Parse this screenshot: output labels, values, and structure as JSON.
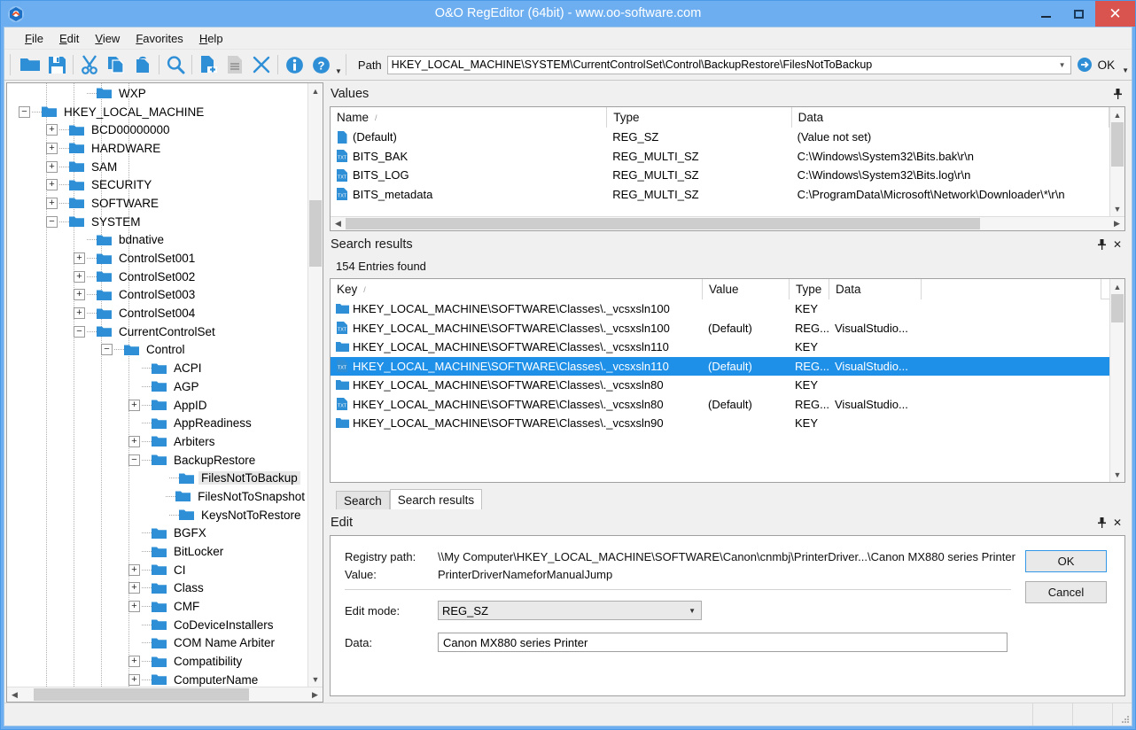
{
  "window": {
    "title": "O&O RegEditor (64bit) - www.oo-software.com",
    "app_icon": "registry-cube-icon",
    "controls": {
      "minimize": "minimize-icon",
      "maximize": "maximize-icon",
      "close": "close-icon"
    }
  },
  "menu": {
    "items": [
      {
        "label": "File",
        "accel": "F"
      },
      {
        "label": "Edit",
        "accel": "E"
      },
      {
        "label": "View",
        "accel": "V"
      },
      {
        "label": "Favorites",
        "accel": "F"
      },
      {
        "label": "Help",
        "accel": "H"
      }
    ]
  },
  "toolbar": {
    "buttons": [
      {
        "name": "open-folder-icon"
      },
      {
        "name": "save-icon"
      },
      {
        "name": "cut-icon"
      },
      {
        "name": "copy-icon"
      },
      {
        "name": "paste-icon"
      },
      {
        "name": "search-icon"
      },
      {
        "name": "new-key-icon"
      },
      {
        "name": "new-value-icon"
      },
      {
        "name": "delete-icon"
      },
      {
        "name": "info-icon"
      },
      {
        "name": "help-icon"
      }
    ],
    "path_label": "Path",
    "path_value": "HKEY_LOCAL_MACHINE\\SYSTEM\\CurrentControlSet\\Control\\BackupRestore\\FilesNotToBackup",
    "go_icon": "go-arrow-icon",
    "ok_label": "OK"
  },
  "tree": {
    "nodes": [
      {
        "label": "WXP",
        "depth": 3,
        "state": "leaf"
      },
      {
        "label": "HKEY_LOCAL_MACHINE",
        "depth": 1,
        "state": "expanded"
      },
      {
        "label": "BCD00000000",
        "depth": 2,
        "state": "collapsed"
      },
      {
        "label": "HARDWARE",
        "depth": 2,
        "state": "collapsed"
      },
      {
        "label": "SAM",
        "depth": 2,
        "state": "collapsed"
      },
      {
        "label": "SECURITY",
        "depth": 2,
        "state": "collapsed"
      },
      {
        "label": "SOFTWARE",
        "depth": 2,
        "state": "collapsed"
      },
      {
        "label": "SYSTEM",
        "depth": 2,
        "state": "expanded"
      },
      {
        "label": "bdnative",
        "depth": 3,
        "state": "leaf"
      },
      {
        "label": "ControlSet001",
        "depth": 3,
        "state": "collapsed"
      },
      {
        "label": "ControlSet002",
        "depth": 3,
        "state": "collapsed"
      },
      {
        "label": "ControlSet003",
        "depth": 3,
        "state": "collapsed"
      },
      {
        "label": "ControlSet004",
        "depth": 3,
        "state": "collapsed"
      },
      {
        "label": "CurrentControlSet",
        "depth": 3,
        "state": "expanded"
      },
      {
        "label": "Control",
        "depth": 4,
        "state": "expanded"
      },
      {
        "label": "ACPI",
        "depth": 5,
        "state": "leaf"
      },
      {
        "label": "AGP",
        "depth": 5,
        "state": "leaf"
      },
      {
        "label": "AppID",
        "depth": 5,
        "state": "collapsed"
      },
      {
        "label": "AppReadiness",
        "depth": 5,
        "state": "leaf"
      },
      {
        "label": "Arbiters",
        "depth": 5,
        "state": "collapsed"
      },
      {
        "label": "BackupRestore",
        "depth": 5,
        "state": "expanded"
      },
      {
        "label": "FilesNotToBackup",
        "depth": 6,
        "state": "leaf",
        "selected": true
      },
      {
        "label": "FilesNotToSnapshot",
        "depth": 6,
        "state": "leaf"
      },
      {
        "label": "KeysNotToRestore",
        "depth": 6,
        "state": "leaf"
      },
      {
        "label": "BGFX",
        "depth": 5,
        "state": "leaf"
      },
      {
        "label": "BitLocker",
        "depth": 5,
        "state": "leaf"
      },
      {
        "label": "CI",
        "depth": 5,
        "state": "collapsed"
      },
      {
        "label": "Class",
        "depth": 5,
        "state": "collapsed"
      },
      {
        "label": "CMF",
        "depth": 5,
        "state": "collapsed"
      },
      {
        "label": "CoDeviceInstallers",
        "depth": 5,
        "state": "leaf"
      },
      {
        "label": "COM Name Arbiter",
        "depth": 5,
        "state": "leaf"
      },
      {
        "label": "Compatibility",
        "depth": 5,
        "state": "collapsed"
      },
      {
        "label": "ComputerName",
        "depth": 5,
        "state": "collapsed"
      }
    ]
  },
  "values_panel": {
    "title": "Values",
    "pin_icon": "pin-icon",
    "columns": [
      "Name",
      "Type",
      "Data"
    ],
    "sort_column": "Name",
    "rows": [
      {
        "icon": "default-value-icon",
        "name": "(Default)",
        "type": "REG_SZ",
        "data": "(Value not set)"
      },
      {
        "icon": "string-value-icon",
        "name": "BITS_BAK",
        "type": "REG_MULTI_SZ",
        "data": "C:\\Windows\\System32\\Bits.bak\\r\\n"
      },
      {
        "icon": "string-value-icon",
        "name": "BITS_LOG",
        "type": "REG_MULTI_SZ",
        "data": "C:\\Windows\\System32\\Bits.log\\r\\n"
      },
      {
        "icon": "string-value-icon",
        "name": "BITS_metadata",
        "type": "REG_MULTI_SZ",
        "data": "C:\\ProgramData\\Microsoft\\Network\\Downloader\\*\\r\\n"
      }
    ]
  },
  "search_panel": {
    "title": "Search results",
    "pin_icon": "pin-icon",
    "close_icon": "close-icon",
    "entries_found": "154 Entries found",
    "columns": [
      "Key",
      "Value",
      "Type",
      "Data",
      ""
    ],
    "sort_column": "Key",
    "rows": [
      {
        "icon": "key-folder-icon",
        "key": "HKEY_LOCAL_MACHINE\\SOFTWARE\\Classes\\._vcsxsln100",
        "value": "",
        "type": "KEY",
        "data": ""
      },
      {
        "icon": "string-value-icon",
        "key": "HKEY_LOCAL_MACHINE\\SOFTWARE\\Classes\\._vcsxsln100",
        "value": "(Default)",
        "type": "REG...",
        "data": "VisualStudio..."
      },
      {
        "icon": "key-folder-icon",
        "key": "HKEY_LOCAL_MACHINE\\SOFTWARE\\Classes\\._vcsxsln110",
        "value": "",
        "type": "KEY",
        "data": ""
      },
      {
        "icon": "string-value-icon",
        "key": "HKEY_LOCAL_MACHINE\\SOFTWARE\\Classes\\._vcsxsln110",
        "value": "(Default)",
        "type": "REG...",
        "data": "VisualStudio...",
        "selected": true
      },
      {
        "icon": "key-folder-icon",
        "key": "HKEY_LOCAL_MACHINE\\SOFTWARE\\Classes\\._vcsxsln80",
        "value": "",
        "type": "KEY",
        "data": ""
      },
      {
        "icon": "string-value-icon",
        "key": "HKEY_LOCAL_MACHINE\\SOFTWARE\\Classes\\._vcsxsln80",
        "value": "(Default)",
        "type": "REG...",
        "data": "VisualStudio..."
      },
      {
        "icon": "key-folder-icon",
        "key": "HKEY_LOCAL_MACHINE\\SOFTWARE\\Classes\\._vcsxsln90",
        "value": "",
        "type": "KEY",
        "data": ""
      }
    ],
    "tabs": [
      {
        "label": "Search",
        "active": false
      },
      {
        "label": "Search results",
        "active": true
      }
    ]
  },
  "edit_panel": {
    "title": "Edit",
    "pin_icon": "pin-icon",
    "close_icon": "close-icon",
    "registry_path_label": "Registry path:",
    "registry_path_value": "\\\\My Computer\\HKEY_LOCAL_MACHINE\\SOFTWARE\\Canon\\cnmbj\\PrinterDriver...\\Canon MX880 series Printer",
    "value_label": "Value:",
    "value_name": "PrinterDriverNameforManualJump",
    "edit_mode_label": "Edit mode:",
    "edit_mode_value": "REG_SZ",
    "data_label": "Data:",
    "data_value": "Canon MX880 series Printer",
    "ok_label": "OK",
    "cancel_label": "Cancel"
  },
  "statusbar": {
    "text": ""
  },
  "colors": {
    "titlebar": "#6daef0",
    "accent": "#1e90e8",
    "icon_blue": "#2f8fd6",
    "close_red": "#d9534f",
    "selection": "#1e90e8"
  }
}
